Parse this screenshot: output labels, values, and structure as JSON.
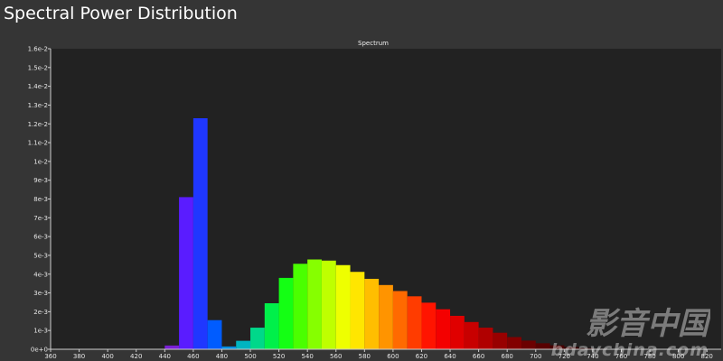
{
  "window": {
    "title": "Spectral Power Distribution"
  },
  "watermark": {
    "text_main": "影音中国",
    "text_url": "bdavchina.com"
  },
  "colors": {
    "background": "#353535",
    "plot_background": "#222222",
    "axis": "#cfcfcf"
  },
  "chart_data": {
    "type": "bar",
    "title": "Spectrum",
    "xlabel": "",
    "ylabel": "",
    "xlim": [
      360,
      830
    ],
    "ylim": [
      0,
      0.016
    ],
    "grid": false,
    "bin_width": 10,
    "x_ticks": [
      360,
      380,
      400,
      420,
      440,
      460,
      480,
      500,
      520,
      540,
      560,
      580,
      600,
      620,
      640,
      660,
      680,
      700,
      720,
      740,
      760,
      780,
      800,
      820
    ],
    "y_ticks": [
      {
        "value": 0,
        "label": "0e+0"
      },
      {
        "value": 0.001,
        "label": "1e-3"
      },
      {
        "value": 0.002,
        "label": "2e-3"
      },
      {
        "value": 0.003,
        "label": "3e-3"
      },
      {
        "value": 0.004,
        "label": "4e-3"
      },
      {
        "value": 0.005,
        "label": "5e-3"
      },
      {
        "value": 0.006,
        "label": "6e-3"
      },
      {
        "value": 0.007,
        "label": "7e-3"
      },
      {
        "value": 0.008,
        "label": "8e-3"
      },
      {
        "value": 0.009,
        "label": "9e-3"
      },
      {
        "value": 0.01,
        "label": "1e-2"
      },
      {
        "value": 0.011,
        "label": "1.1e-2"
      },
      {
        "value": 0.012,
        "label": "1.2e-2"
      },
      {
        "value": 0.013,
        "label": "1.3e-2"
      },
      {
        "value": 0.014,
        "label": "1.4e-2"
      },
      {
        "value": 0.015,
        "label": "1.5e-2"
      },
      {
        "value": 0.016,
        "label": "1.6e-2"
      }
    ],
    "bins": [
      {
        "x": 440,
        "y": 0.0002,
        "color": "#7a1fd6"
      },
      {
        "x": 450,
        "y": 0.0081,
        "color": "#5a1cff"
      },
      {
        "x": 460,
        "y": 0.0123,
        "color": "#1f37ff"
      },
      {
        "x": 470,
        "y": 0.00155,
        "color": "#005cff"
      },
      {
        "x": 480,
        "y": 0.00015,
        "color": "#008fe0"
      },
      {
        "x": 490,
        "y": 0.00045,
        "color": "#00b4c0"
      },
      {
        "x": 500,
        "y": 0.00115,
        "color": "#00d88a"
      },
      {
        "x": 510,
        "y": 0.00245,
        "color": "#00f04a"
      },
      {
        "x": 520,
        "y": 0.0038,
        "color": "#14ff14"
      },
      {
        "x": 530,
        "y": 0.00455,
        "color": "#4aff00"
      },
      {
        "x": 540,
        "y": 0.00478,
        "color": "#86ff00"
      },
      {
        "x": 550,
        "y": 0.00472,
        "color": "#bfff00"
      },
      {
        "x": 560,
        "y": 0.00448,
        "color": "#eeff00"
      },
      {
        "x": 570,
        "y": 0.00412,
        "color": "#ffe600"
      },
      {
        "x": 580,
        "y": 0.00375,
        "color": "#ffbe00"
      },
      {
        "x": 590,
        "y": 0.00342,
        "color": "#ff9400"
      },
      {
        "x": 600,
        "y": 0.0031,
        "color": "#ff6a00"
      },
      {
        "x": 610,
        "y": 0.00282,
        "color": "#ff3c00"
      },
      {
        "x": 620,
        "y": 0.00248,
        "color": "#ff1400"
      },
      {
        "x": 630,
        "y": 0.00213,
        "color": "#f40000"
      },
      {
        "x": 640,
        "y": 0.00178,
        "color": "#e00000"
      },
      {
        "x": 650,
        "y": 0.00145,
        "color": "#c80000"
      },
      {
        "x": 660,
        "y": 0.00115,
        "color": "#b00000"
      },
      {
        "x": 670,
        "y": 0.00088,
        "color": "#980000"
      },
      {
        "x": 680,
        "y": 0.00065,
        "color": "#820000"
      },
      {
        "x": 690,
        "y": 0.00046,
        "color": "#6c0000"
      },
      {
        "x": 700,
        "y": 0.00032,
        "color": "#580000"
      },
      {
        "x": 710,
        "y": 0.00021,
        "color": "#480000"
      },
      {
        "x": 720,
        "y": 0.00012,
        "color": "#3a0000"
      },
      {
        "x": 730,
        "y": 6e-05,
        "color": "#300000"
      },
      {
        "x": 740,
        "y": 3e-05,
        "color": "#2a0000"
      }
    ]
  }
}
